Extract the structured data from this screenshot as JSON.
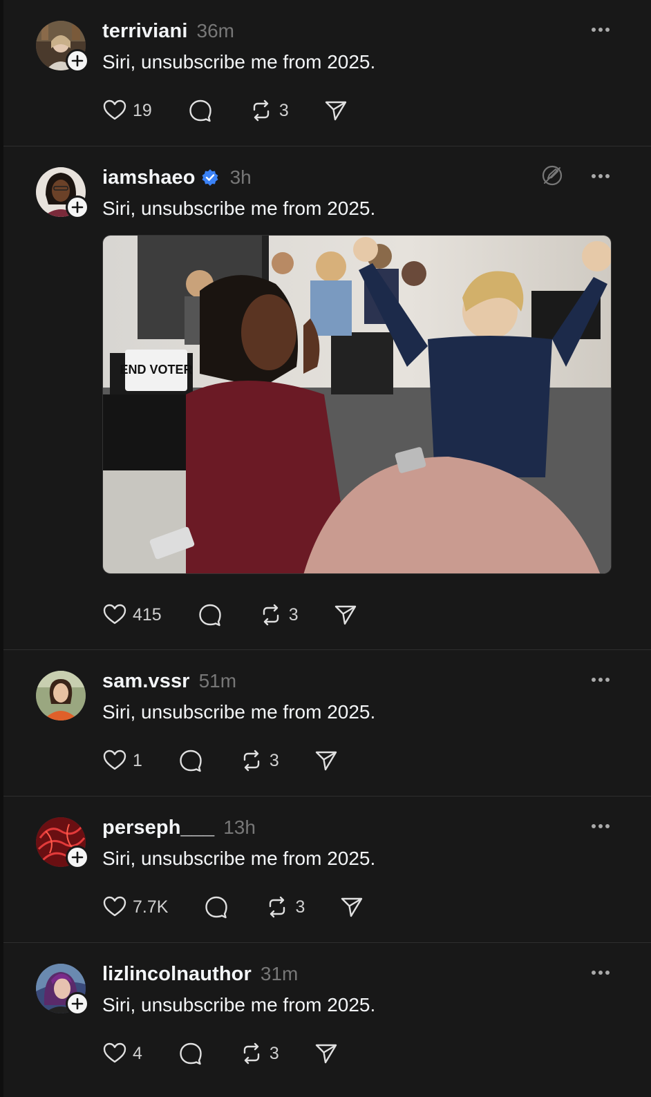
{
  "posts": [
    {
      "username": "terriviani",
      "time": "36m",
      "verified": false,
      "text": "Siri, unsubscribe me from 2025.",
      "likes": "19",
      "comments": "",
      "reposts": "3",
      "avatar_color": "#6b5a48"
    },
    {
      "username": "iamshaeo",
      "time": "3h",
      "verified": true,
      "text": "Siri, unsubscribe me from 2025.",
      "likes": "415",
      "comments": "",
      "reposts": "3",
      "avatar_color": "#c8b9a6",
      "image_sign_text": "END VOTER"
    },
    {
      "username": "sam.vssr",
      "time": "51m",
      "verified": false,
      "text": "Siri, unsubscribe me from 2025.",
      "likes": "1",
      "comments": "",
      "reposts": "3",
      "avatar_color": "#7e8a6a"
    },
    {
      "username": "perseph___",
      "time": "13h",
      "verified": false,
      "text": "Siri, unsubscribe me from 2025.",
      "likes": "7.7K",
      "comments": "",
      "reposts": "3",
      "avatar_color": "#8a1a1a"
    },
    {
      "username": "lizlincolnauthor",
      "time": "31m",
      "verified": false,
      "text": "Siri, unsubscribe me from 2025.",
      "likes": "4",
      "comments": "",
      "reposts": "3",
      "avatar_color": "#4a3a6a"
    }
  ],
  "icons": {
    "like": "heart-icon",
    "comment": "comment-bubble-icon",
    "repost": "repost-icon",
    "share": "send-icon",
    "more": "more-dots-icon",
    "follow": "plus-icon",
    "verified": "verified-badge-icon",
    "mute": "mute-icon"
  },
  "colors": {
    "background": "#181818",
    "divider": "#2e2e2e",
    "verified": "#3b82f6",
    "muted_text": "#777777"
  }
}
